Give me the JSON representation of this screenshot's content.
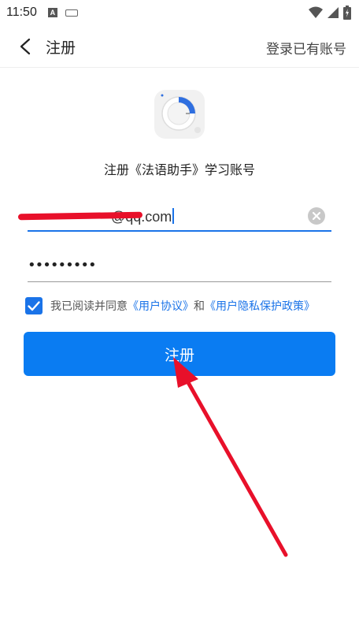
{
  "status_bar": {
    "time": "11:50",
    "a_badge": "A"
  },
  "header": {
    "title": "注册",
    "login_link": "登录已有账号"
  },
  "logo": {
    "icon": "app-logo-dial-icon"
  },
  "subtitle": "注册《法语助手》学习账号",
  "form": {
    "email_visible_value": "@qq.com",
    "email_redacted": true,
    "password_masked": "•••••••••",
    "agreement": {
      "checked": true,
      "prefix": "我已阅读并同意",
      "user_agreement": "《用户协议》",
      "conjunction": "和",
      "privacy_policy": "《用户隐私保护政策》"
    },
    "submit_label": "注册"
  },
  "colors": {
    "accent": "#1a73e8",
    "button": "#0a7cf2",
    "annotation": "#e8102a"
  }
}
